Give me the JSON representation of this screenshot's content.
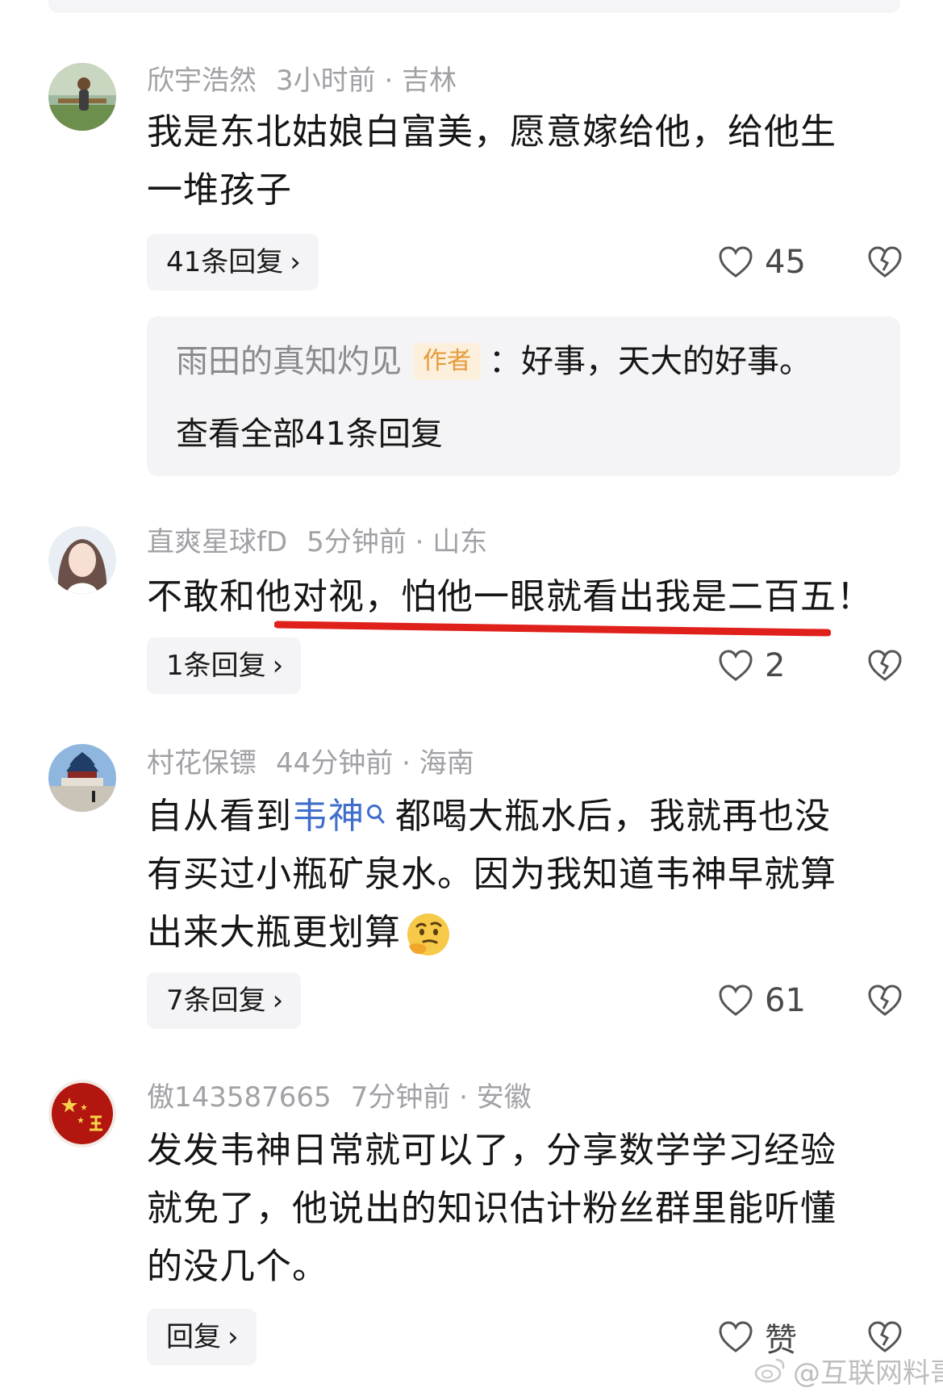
{
  "comments": [
    {
      "username": "欣宇浩然",
      "time": "3小时前",
      "location": "吉林",
      "text_lines": [
        "我是东北姑娘白富美，愿意嫁给他，给他生",
        "一堆孩子"
      ],
      "reply_label": "41条回复",
      "likes": "45",
      "author_reply": {
        "name": "雨田的真知灼见",
        "badge": "作者",
        "text": "：好事，天大的好事。",
        "view_all": "查看全部41条回复"
      }
    },
    {
      "username": "直爽星球fD",
      "time": "5分钟前",
      "location": "山东",
      "text_lines": [
        "不敢和他对视，怕他一眼就看出我是二百五！"
      ],
      "reply_label": "1条回复",
      "likes": "2"
    },
    {
      "username": "村花保镖",
      "time": "44分钟前",
      "location": "海南",
      "text_line1_before": "自从看到",
      "topic": "韦神",
      "text_line1_after": "都喝大瓶水后，我就再也没",
      "text_line2": "有买过小瓶矿泉水。因为我知道韦神早就算",
      "text_line3": "出来大瓶更划算",
      "emoji": "thinking-emoji",
      "reply_label": "7条回复",
      "likes": "61"
    },
    {
      "username": "傲143587665",
      "time": "7分钟前",
      "location": "安徽",
      "text_lines": [
        "发发韦神日常就可以了，分享数学学习经验",
        "就免了，他说出的知识估计粉丝群里能听懂",
        "的没几个。"
      ],
      "reply_label": "回复",
      "likes": "赞"
    }
  ],
  "separator": "·",
  "chevron": "›",
  "watermark": "@互联网料哥",
  "colors": {
    "meta_gray": "#a1a1a6",
    "link_blue": "#3f6ecc",
    "badge_orange": "#e59b3a",
    "annotation_red": "#e0201b"
  },
  "icons": [
    "heart-icon",
    "broken-heart-icon",
    "search-icon",
    "weibo-logo-icon"
  ]
}
